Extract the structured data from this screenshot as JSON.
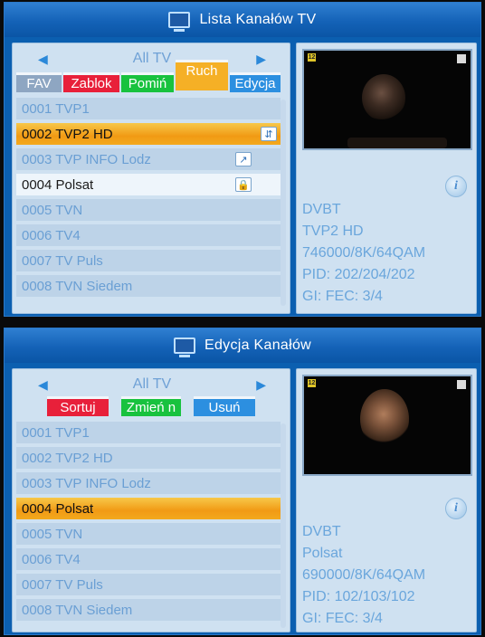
{
  "screen1": {
    "title": "Lista Kanałów TV",
    "group": "All TV",
    "buttons": [
      {
        "label": "FAV"
      },
      {
        "label": "Zablok"
      },
      {
        "label": "Pomiń"
      },
      {
        "label": "Ruch"
      },
      {
        "label": "Edycja"
      }
    ],
    "channels": [
      {
        "label": "0001 TVP1"
      },
      {
        "label": "0002 TVP2 HD"
      },
      {
        "label": "0003 TVP INFO Lodz"
      },
      {
        "label": "0004 Polsat"
      },
      {
        "label": "0005 TVN"
      },
      {
        "label": "0006 TV4"
      },
      {
        "label": "0007 TV Puls"
      },
      {
        "label": "0008 TVN Siedem"
      }
    ],
    "preview_age": "12",
    "info": {
      "type": "DVBT",
      "name": "TVP2 HD",
      "freq": "746000/8K/64QAM",
      "pid": "PID: 202/204/202",
      "gi": "GI:   FEC: 3/4"
    }
  },
  "screen2": {
    "title": "Edycja Kanałów",
    "group": "All TV",
    "buttons": [
      {
        "label": "Sortuj"
      },
      {
        "label": "Zmień n"
      },
      {
        "label": "Usuń"
      }
    ],
    "channels": [
      {
        "label": "0001 TVP1"
      },
      {
        "label": "0002 TVP2 HD"
      },
      {
        "label": "0003 TVP INFO Lodz"
      },
      {
        "label": "0004 Polsat"
      },
      {
        "label": "0005 TVN"
      },
      {
        "label": "0006 TV4"
      },
      {
        "label": "0007 TV Puls"
      },
      {
        "label": "0008 TVN Siedem"
      }
    ],
    "preview_age": "12",
    "info": {
      "type": "DVBT",
      "name": "Polsat",
      "freq": "690000/8K/64QAM",
      "pid": "PID: 102/103/102",
      "gi": "GI:   FEC: 3/4"
    }
  },
  "icons": {
    "left_arrow": "◀",
    "right_arrow": "▶",
    "info": "i",
    "lock": "🔒",
    "move": "⇵",
    "edit": "↗"
  },
  "colors": {
    "background": "#0b5fb0",
    "selection": "#f19a14",
    "fav": "#8ea6c2",
    "red": "#e8203a",
    "green": "#18c23e",
    "yellow": "#f5b026",
    "blue": "#2c8fe0"
  }
}
